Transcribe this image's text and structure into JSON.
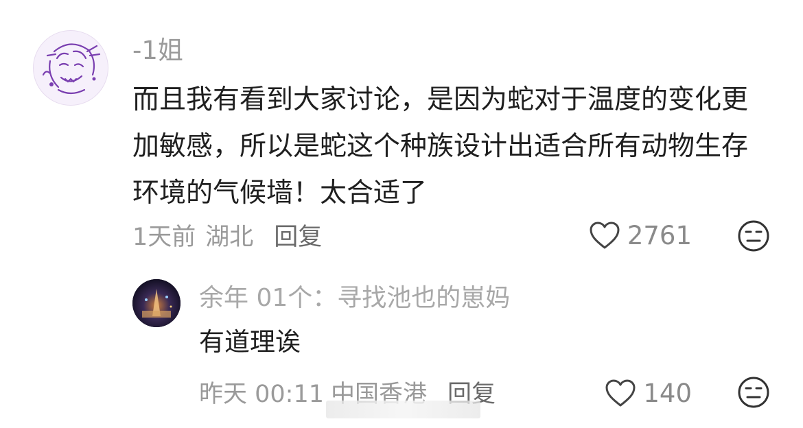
{
  "comment": {
    "username": "-1姐",
    "text": "而且我有看到大家讨论，是因为蛇对于温度的变化更加敏感，所以是蛇这个种族设计出适合所有动物生存环境的气候墙！太合适了",
    "time": "1天前",
    "location": "湖北",
    "reply_label": "回复",
    "like_count": "2761",
    "icons": {
      "like": "heart-outline-icon",
      "reaction": "meh-face-icon"
    }
  },
  "reply": {
    "header": "余年 01个：寻找池也的崽妈",
    "text": "有道理诶",
    "time": "昨天 00:11",
    "location": "中国香港",
    "reply_label": "回复",
    "like_count": "140",
    "icons": {
      "like": "heart-outline-icon",
      "reaction": "meh-face-icon"
    }
  },
  "colors": {
    "secondary_text": "#9a9a9a",
    "primary_text": "#1f1f1f",
    "avatar_accent": "#7a3fb0"
  }
}
